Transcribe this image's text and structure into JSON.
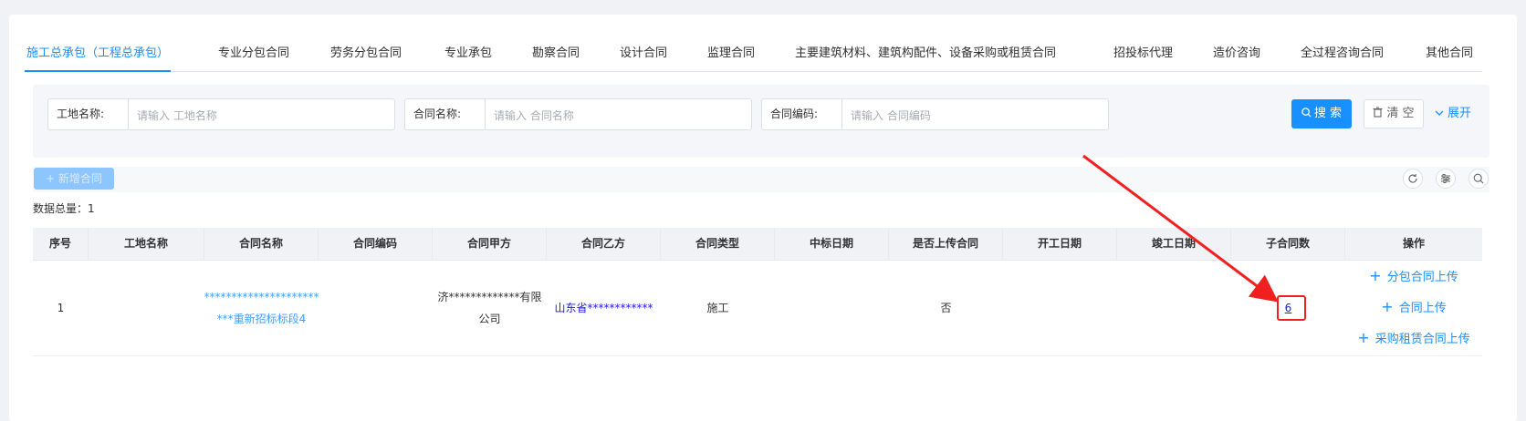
{
  "tabs": [
    {
      "label": "施工总承包（工程总承包）",
      "active": true
    },
    {
      "label": "专业分包合同"
    },
    {
      "label": "劳务分包合同"
    },
    {
      "label": "专业承包"
    },
    {
      "label": "勘察合同"
    },
    {
      "label": "设计合同"
    },
    {
      "label": "监理合同"
    },
    {
      "label": "主要建筑材料、建筑构配件、设备采购或租赁合同"
    },
    {
      "label": "招投标代理"
    },
    {
      "label": "造价咨询"
    },
    {
      "label": "全过程咨询合同"
    },
    {
      "label": "其他合同"
    }
  ],
  "filters": {
    "site_name": {
      "label": "工地名称:",
      "placeholder": "请输入 工地名称",
      "value": ""
    },
    "contract_name": {
      "label": "合同名称:",
      "placeholder": "请输入 合同名称",
      "value": ""
    },
    "contract_code": {
      "label": "合同编码:",
      "placeholder": "请输入 合同编码",
      "value": ""
    },
    "search_label": "搜 索",
    "clear_label": "清 空",
    "expand_label": "展开"
  },
  "toolbar": {
    "add_label": "+ 新增合同",
    "total_label": "数据总量：1"
  },
  "table": {
    "headers": [
      "序号",
      "工地名称",
      "合同名称",
      "合同编码",
      "合同甲方",
      "合同乙方",
      "合同类型",
      "中标日期",
      "是否上传合同",
      "开工日期",
      "竣工日期",
      "子合同数",
      "操作"
    ],
    "rows": [
      {
        "index": "1",
        "site_name": "",
        "contract_name_line1": "*********************",
        "contract_name_line2": "***重新招标标段4",
        "contract_code": "",
        "party_a_line1": "济*************有限",
        "party_a_line2": "公司",
        "party_b": "山东省************",
        "contract_type": "施工",
        "bid_date": "",
        "uploaded": "否",
        "start_date": "",
        "end_date": "",
        "sub_count": "6",
        "actions": [
          "分包合同上传",
          "合同上传",
          "采购租赁合同上传"
        ]
      }
    ]
  },
  "colors": {
    "primary": "#1890ff",
    "highlight": "#f02020"
  }
}
